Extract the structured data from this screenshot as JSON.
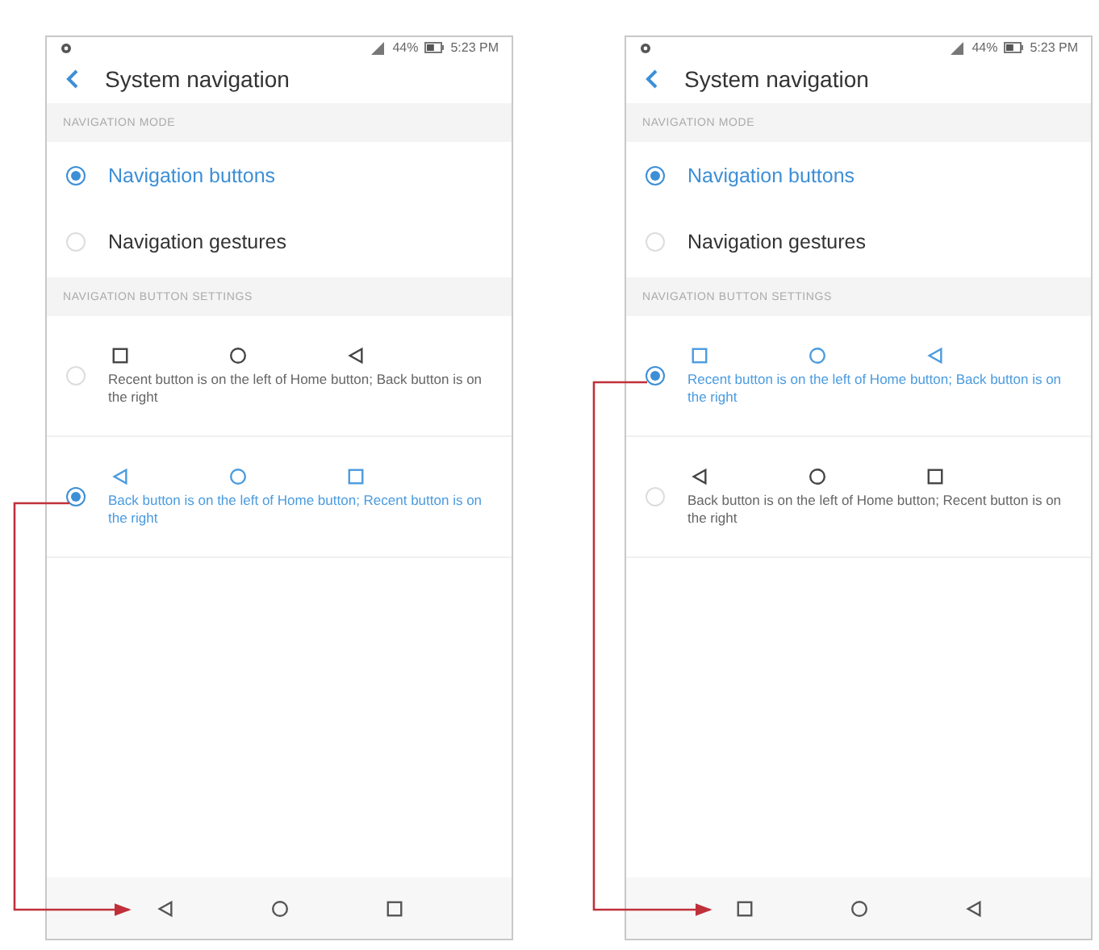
{
  "phones": [
    {
      "status": {
        "battery": "44%",
        "time": "5:23 PM"
      },
      "title": "System navigation",
      "mode_header": "NAVIGATION MODE",
      "modes": [
        {
          "label": "Navigation buttons",
          "selected": true
        },
        {
          "label": "Navigation gestures",
          "selected": false
        }
      ],
      "layout_header": "NAVIGATION BUTTON SETTINGS",
      "layouts": [
        {
          "icons": [
            {
              "kind": "recent"
            },
            {
              "kind": "home"
            },
            {
              "kind": "back"
            }
          ],
          "description": "Recent button is on the left of Home button; Back button is on the right",
          "selected": false
        },
        {
          "icons": [
            {
              "kind": "back"
            },
            {
              "kind": "home"
            },
            {
              "kind": "recent"
            }
          ],
          "description": "Back button is on the left of Home button; Recent button is on the right",
          "selected": true
        }
      ],
      "nav_bar": [
        {
          "kind": "back"
        },
        {
          "kind": "home"
        },
        {
          "kind": "recent"
        }
      ]
    },
    {
      "status": {
        "battery": "44%",
        "time": "5:23 PM"
      },
      "title": "System navigation",
      "mode_header": "NAVIGATION MODE",
      "modes": [
        {
          "label": "Navigation buttons",
          "selected": true
        },
        {
          "label": "Navigation gestures",
          "selected": false
        }
      ],
      "layout_header": "NAVIGATION BUTTON SETTINGS",
      "layouts": [
        {
          "icons": [
            {
              "kind": "recent"
            },
            {
              "kind": "home"
            },
            {
              "kind": "back"
            }
          ],
          "description": "Recent button is on the left of Home button; Back button is on the right",
          "selected": true
        },
        {
          "icons": [
            {
              "kind": "back"
            },
            {
              "kind": "home"
            },
            {
              "kind": "recent"
            }
          ],
          "description": "Back button is on the left of Home button; Recent button is on the right",
          "selected": false
        }
      ],
      "nav_bar": [
        {
          "kind": "recent"
        },
        {
          "kind": "home"
        },
        {
          "kind": "back"
        }
      ]
    }
  ]
}
